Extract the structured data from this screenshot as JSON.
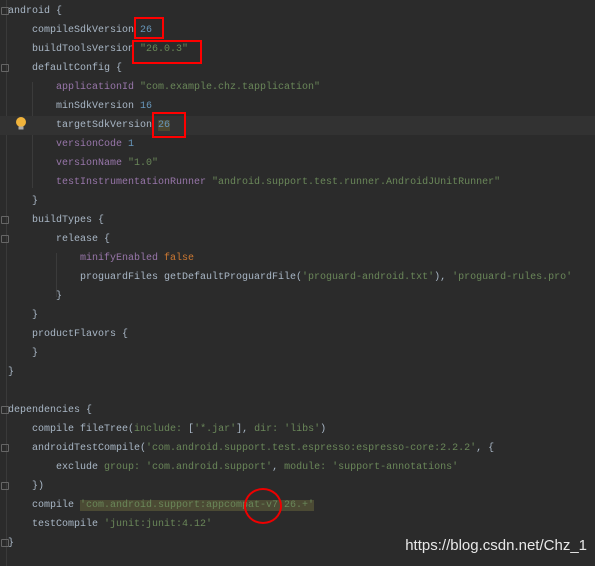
{
  "colors": {
    "background": "#2b2b2b",
    "plain": "#a9b7c6",
    "number": "#6897bb",
    "string": "#6a8759",
    "property": "#9876aa",
    "keyword": "#cc7832",
    "annotation_red": "#ff0000"
  },
  "lines": [
    {
      "indent": 0,
      "tokens": [
        [
          "plain",
          "android {"
        ]
      ]
    },
    {
      "indent": 1,
      "tokens": [
        [
          "plain",
          "compileSdkVersion "
        ],
        [
          "num",
          "26"
        ]
      ]
    },
    {
      "indent": 1,
      "tokens": [
        [
          "plain",
          "buildToolsVersion "
        ],
        [
          "str",
          "\"26.0.3\""
        ]
      ]
    },
    {
      "indent": 1,
      "tokens": [
        [
          "plain",
          "defaultConfig {"
        ]
      ]
    },
    {
      "indent": 2,
      "tokens": [
        [
          "prop",
          "applicationId "
        ],
        [
          "str",
          "\"com.example.chz.tapplication\""
        ]
      ]
    },
    {
      "indent": 2,
      "tokens": [
        [
          "plain",
          "minSdkVersion "
        ],
        [
          "num",
          "16"
        ]
      ]
    },
    {
      "indent": 2,
      "current": true,
      "tokens": [
        [
          "plain",
          "targetSdkVersion "
        ],
        [
          "num",
          "26"
        ]
      ]
    },
    {
      "indent": 2,
      "tokens": [
        [
          "prop",
          "versionCode "
        ],
        [
          "num",
          "1"
        ]
      ]
    },
    {
      "indent": 2,
      "tokens": [
        [
          "prop",
          "versionName "
        ],
        [
          "str",
          "\"1.0\""
        ]
      ]
    },
    {
      "indent": 2,
      "tokens": [
        [
          "prop",
          "testInstrumentationRunner "
        ],
        [
          "str",
          "\"android.support.test.runner.AndroidJUnitRunner\""
        ]
      ]
    },
    {
      "indent": 1,
      "tokens": [
        [
          "plain",
          "}"
        ]
      ]
    },
    {
      "indent": 1,
      "tokens": [
        [
          "plain",
          "buildTypes {"
        ]
      ]
    },
    {
      "indent": 2,
      "tokens": [
        [
          "plain",
          "release {"
        ]
      ]
    },
    {
      "indent": 3,
      "tokens": [
        [
          "prop",
          "minifyEnabled "
        ],
        [
          "kw",
          "false"
        ]
      ]
    },
    {
      "indent": 3,
      "tokens": [
        [
          "plain",
          "proguardFiles getDefaultProguardFile("
        ],
        [
          "str",
          "'proguard-android.txt'"
        ],
        [
          "plain",
          "), "
        ],
        [
          "str",
          "'proguard-rules.pro'"
        ]
      ]
    },
    {
      "indent": 2,
      "tokens": [
        [
          "plain",
          "}"
        ]
      ]
    },
    {
      "indent": 1,
      "tokens": [
        [
          "plain",
          "}"
        ]
      ]
    },
    {
      "indent": 1,
      "tokens": [
        [
          "plain",
          "productFlavors {"
        ]
      ]
    },
    {
      "indent": 1,
      "tokens": [
        [
          "plain",
          "}"
        ]
      ]
    },
    {
      "indent": 0,
      "tokens": [
        [
          "plain",
          "}"
        ]
      ]
    },
    {
      "indent": 0,
      "tokens": []
    },
    {
      "indent": 0,
      "tokens": [
        [
          "plain",
          "dependencies {"
        ]
      ]
    },
    {
      "indent": 1,
      "tokens": [
        [
          "plain",
          "compile fileTree("
        ],
        [
          "arg",
          "include: "
        ],
        [
          "plain",
          "["
        ],
        [
          "str",
          "'*.jar'"
        ],
        [
          "plain",
          "], "
        ],
        [
          "arg",
          "dir: "
        ],
        [
          "str",
          "'libs'"
        ],
        [
          "plain",
          ")"
        ]
      ]
    },
    {
      "indent": 1,
      "tokens": [
        [
          "plain",
          "androidTestCompile("
        ],
        [
          "str",
          "'com.android.support.test.espresso:espresso-core:2.2.2'"
        ],
        [
          "plain",
          ", {"
        ]
      ]
    },
    {
      "indent": 2,
      "tokens": [
        [
          "plain",
          "exclude "
        ],
        [
          "arg",
          "group: "
        ],
        [
          "str",
          "'com.android.support'"
        ],
        [
          "plain",
          ", "
        ],
        [
          "arg",
          "module: "
        ],
        [
          "str",
          "'support-annotations'"
        ]
      ]
    },
    {
      "indent": 1,
      "tokens": [
        [
          "plain",
          "})"
        ]
      ]
    },
    {
      "indent": 1,
      "tokens": [
        [
          "plain",
          "compile "
        ],
        [
          "strhl",
          "'com.android.support:appcompat-v7:26.+'"
        ]
      ]
    },
    {
      "indent": 1,
      "tokens": [
        [
          "plain",
          "testCompile "
        ],
        [
          "str",
          "'junit:junit:4.12'"
        ]
      ]
    },
    {
      "indent": 0,
      "tokens": [
        [
          "plain",
          "}"
        ]
      ]
    }
  ],
  "watermark": "https://blog.csdn.net/Chz_1"
}
